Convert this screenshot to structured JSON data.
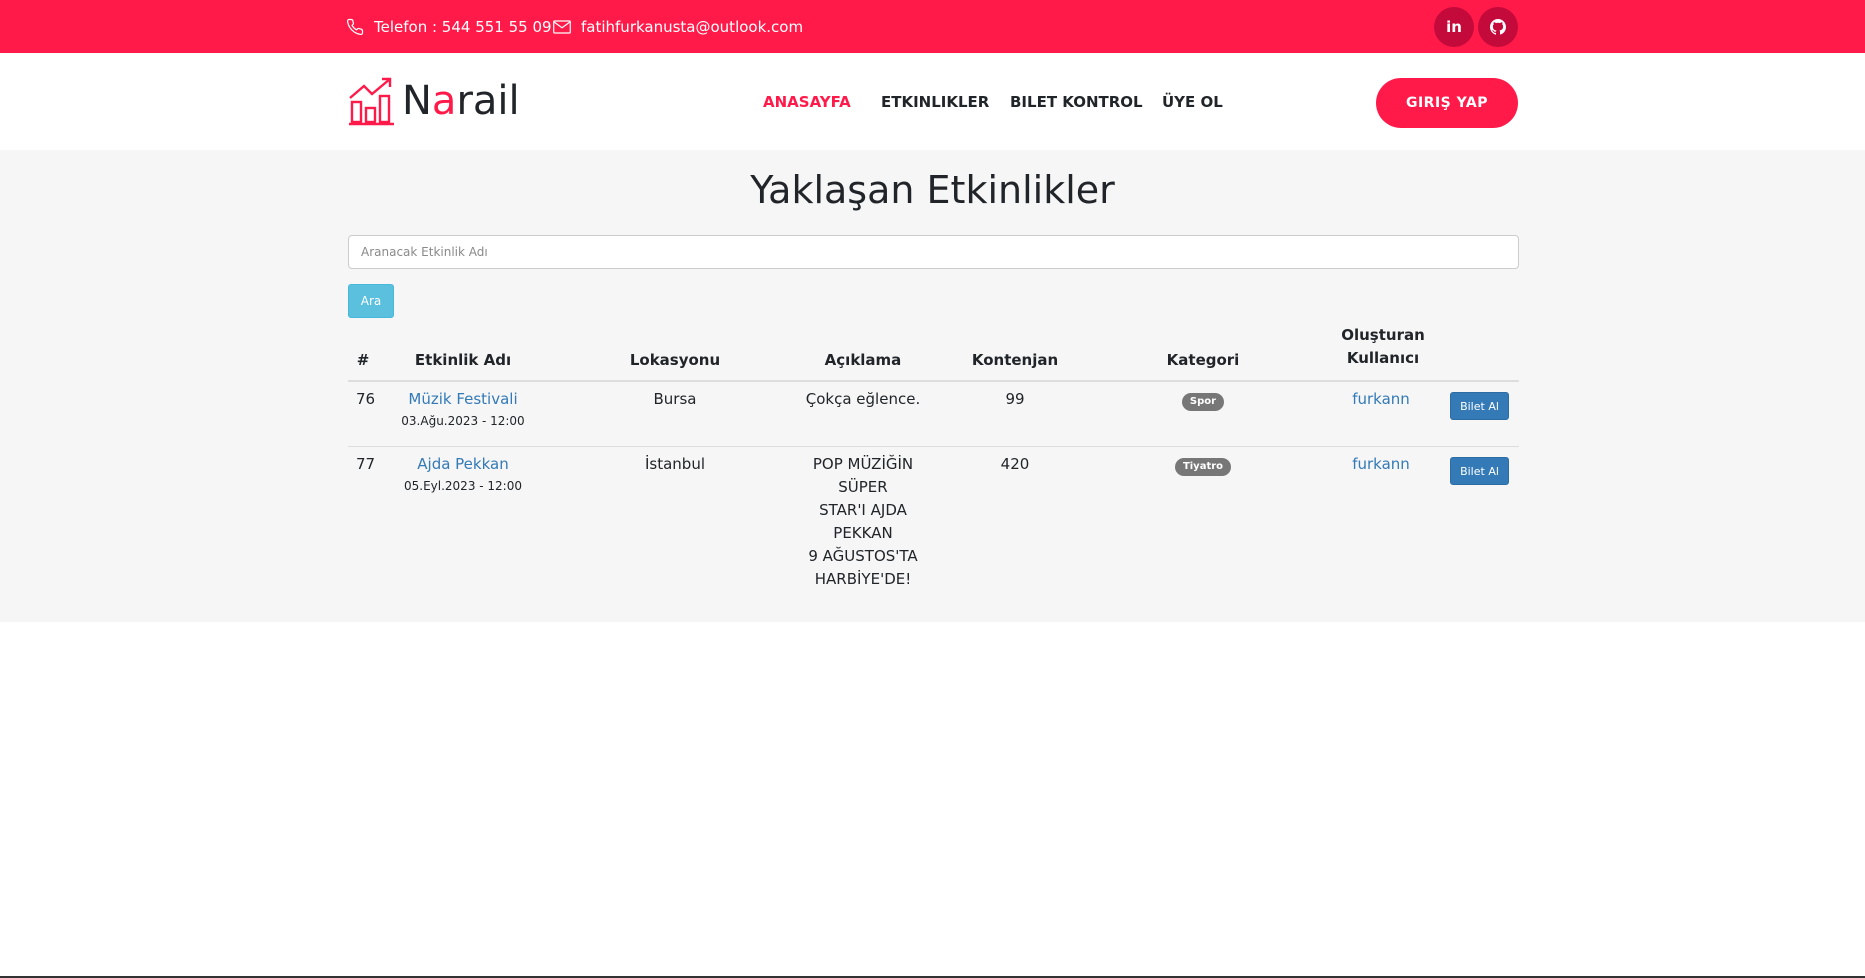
{
  "topbar": {
    "phone": "Telefon : 544 551 55 09",
    "email": "fatihfurkanusta@outlook.com",
    "linkedin_label": "in",
    "github_icon": "github-icon"
  },
  "brand": {
    "name_prefix": "N",
    "name_accent": "a",
    "name_suffix": "rail",
    "accent_color": "#ff1a4a"
  },
  "nav": {
    "items": [
      {
        "label": "ANASAYFA",
        "active": true
      },
      {
        "label": "ETKINLIKLER"
      },
      {
        "label": "BILET KONTROL"
      },
      {
        "label": "ÜYE OL"
      }
    ],
    "login": "GIRIŞ YAP"
  },
  "main": {
    "title": "Yaklaşan Etkinlikler",
    "search_placeholder": "Aranacak Etkinlik Adı",
    "search_button": "Ara",
    "table": {
      "headers": [
        "#",
        "Etkinlik Adı",
        "Lokasyonu",
        "Açıklama",
        "Kontenjan",
        "Kategori",
        "Oluşturan",
        "Kullanıcı"
      ],
      "rows": [
        {
          "id": "76",
          "name": "Müzik Festivali",
          "date": "03.Ağu.2023 - 12:00",
          "location": "Bursa",
          "description": "Çokça eğlence.",
          "capacity": "99",
          "category": "Spor",
          "user": "furkann",
          "action": "Bilet Al"
        },
        {
          "id": "77",
          "name": "Ajda Pekkan",
          "date": "05.Eyl.2023 - 12:00",
          "location": "İstanbul",
          "description_lines": [
            "POP MÜZİĞİN SÜPER",
            "STAR'I AJDA PEKKAN",
            "9 AĞUSTOS'TA",
            "HARBİYE'DE!"
          ],
          "capacity": "420",
          "category": "Tiyatro",
          "user": "furkann",
          "action": "Bilet Al"
        }
      ]
    }
  }
}
